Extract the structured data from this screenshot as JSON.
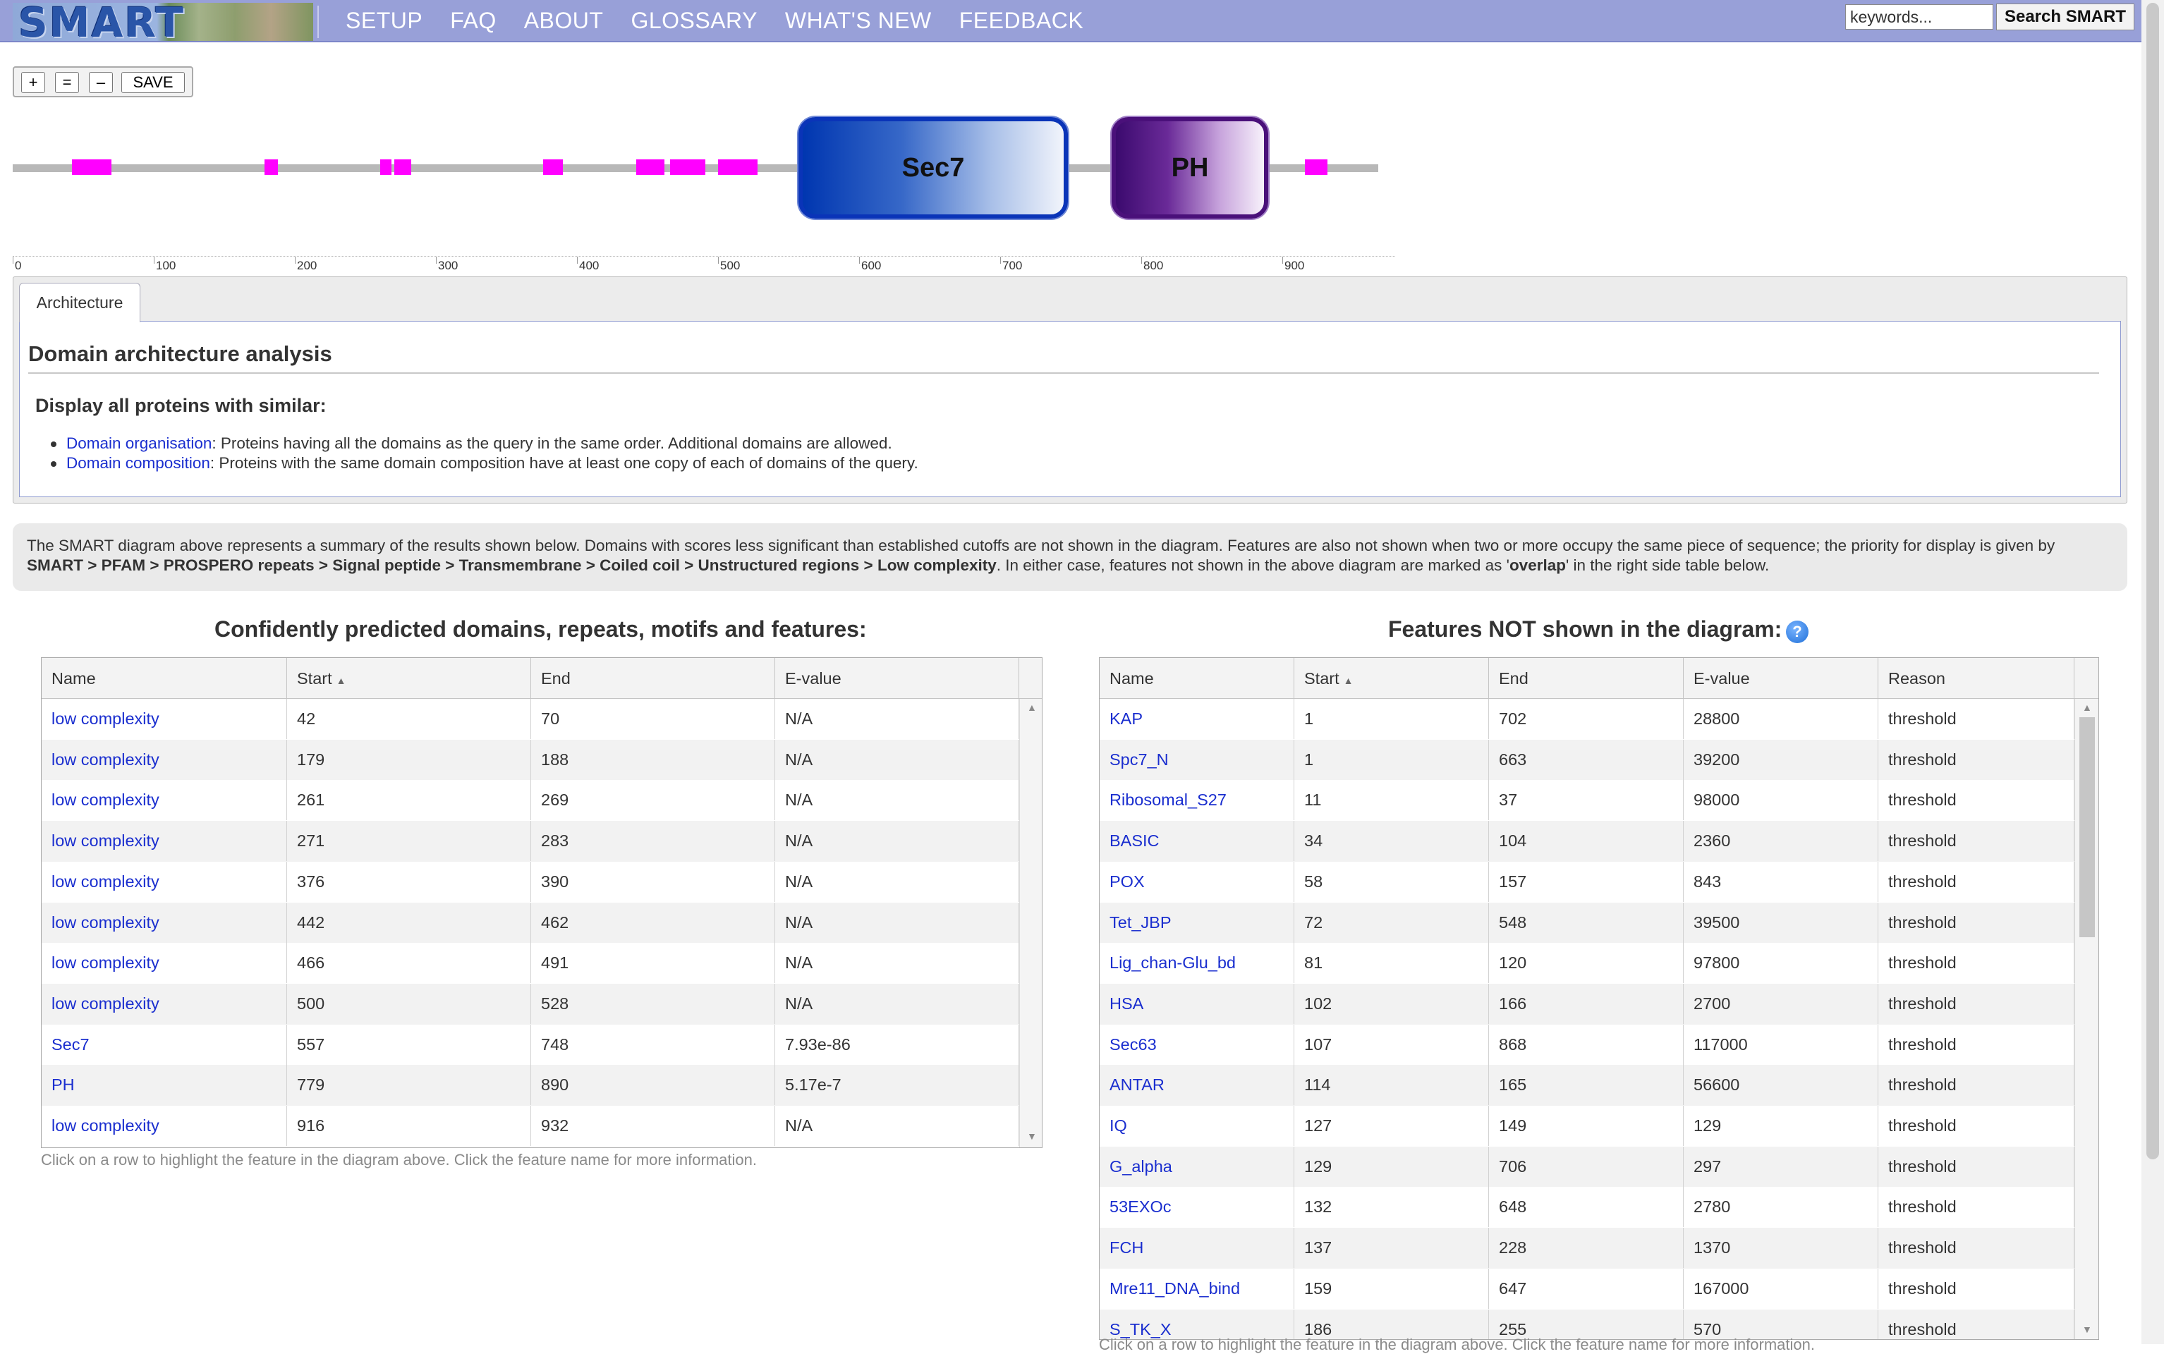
{
  "header": {
    "logo_text": "SMART",
    "nav": [
      "SETUP",
      "FAQ",
      "ABOUT",
      "GLOSSARY",
      "WHAT'S NEW",
      "FEEDBACK"
    ],
    "search_placeholder": "keywords...",
    "search_button": "Search SMART"
  },
  "zoom": {
    "plus": "+",
    "equal": "=",
    "minus": "–",
    "save": "SAVE"
  },
  "diagram": {
    "domains": [
      {
        "name": "Sec7",
        "start": 557,
        "end": 748,
        "color": "#0036b0"
      },
      {
        "name": "PH",
        "start": 779,
        "end": 890,
        "color": "#3b0a6e"
      }
    ],
    "low_complexity_color": "#ff00ff",
    "ruler_ticks": [
      "0",
      "100",
      "200",
      "300",
      "400",
      "500",
      "600",
      "700",
      "800",
      "900"
    ]
  },
  "architecture": {
    "tab": "Architecture",
    "heading": "Domain architecture analysis",
    "subheading": "Display all proteins with similar:",
    "items": [
      {
        "link": "Domain organisation",
        "text": ": Proteins having all the domains as the query in the same order. Additional domains are allowed."
      },
      {
        "link": "Domain composition",
        "text": ": Proteins with the same domain composition have at least one copy of each of domains of the query."
      }
    ]
  },
  "info": {
    "text1": "The SMART diagram above represents a summary of the results shown below. Domains with scores less significant than established cutoffs are not shown in the diagram. Features are also not shown when two or more occupy the same piece of sequence; the priority for display is given by ",
    "priority": "SMART > PFAM > PROSPERO repeats > Signal peptide > Transmembrane > Coiled coil > Unstructured regions > Low complexity",
    "text2": ". In either case, features not shown in the above diagram are marked as '",
    "overlap": "overlap",
    "text3": "' in the right side table below."
  },
  "left_table": {
    "title": "Confidently predicted domains, repeats, motifs and features:",
    "columns": [
      "Name",
      "Start",
      "End",
      "E-value"
    ],
    "rows": [
      [
        "low complexity",
        "42",
        "70",
        "N/A"
      ],
      [
        "low complexity",
        "179",
        "188",
        "N/A"
      ],
      [
        "low complexity",
        "261",
        "269",
        "N/A"
      ],
      [
        "low complexity",
        "271",
        "283",
        "N/A"
      ],
      [
        "low complexity",
        "376",
        "390",
        "N/A"
      ],
      [
        "low complexity",
        "442",
        "462",
        "N/A"
      ],
      [
        "low complexity",
        "466",
        "491",
        "N/A"
      ],
      [
        "low complexity",
        "500",
        "528",
        "N/A"
      ],
      [
        "Sec7",
        "557",
        "748",
        "7.93e-86"
      ],
      [
        "PH",
        "779",
        "890",
        "5.17e-7"
      ],
      [
        "low complexity",
        "916",
        "932",
        "N/A"
      ]
    ],
    "footnote": "Click on a row to highlight the feature in the diagram above. Click the feature name for more information."
  },
  "right_table": {
    "title": "Features NOT shown in the diagram:",
    "columns": [
      "Name",
      "Start",
      "End",
      "E-value",
      "Reason"
    ],
    "rows": [
      [
        "KAP",
        "1",
        "702",
        "28800",
        "threshold"
      ],
      [
        "Spc7_N",
        "1",
        "663",
        "39200",
        "threshold"
      ],
      [
        "Ribosomal_S27",
        "11",
        "37",
        "98000",
        "threshold"
      ],
      [
        "BASIC",
        "34",
        "104",
        "2360",
        "threshold"
      ],
      [
        "POX",
        "58",
        "157",
        "843",
        "threshold"
      ],
      [
        "Tet_JBP",
        "72",
        "548",
        "39500",
        "threshold"
      ],
      [
        "Lig_chan-Glu_bd",
        "81",
        "120",
        "97800",
        "threshold"
      ],
      [
        "HSA",
        "102",
        "166",
        "2700",
        "threshold"
      ],
      [
        "Sec63",
        "107",
        "868",
        "117000",
        "threshold"
      ],
      [
        "ANTAR",
        "114",
        "165",
        "56600",
        "threshold"
      ],
      [
        "IQ",
        "127",
        "149",
        "129",
        "threshold"
      ],
      [
        "G_alpha",
        "129",
        "706",
        "297",
        "threshold"
      ],
      [
        "53EXOc",
        "132",
        "648",
        "2780",
        "threshold"
      ],
      [
        "FCH",
        "137",
        "228",
        "1370",
        "threshold"
      ],
      [
        "Mre11_DNA_bind",
        "159",
        "647",
        "167000",
        "threshold"
      ],
      [
        "S_TK_X",
        "186",
        "255",
        "570",
        "threshold"
      ]
    ],
    "footnote": "Click on a row to highlight the feature in the diagram above. Click the feature name for more information."
  }
}
